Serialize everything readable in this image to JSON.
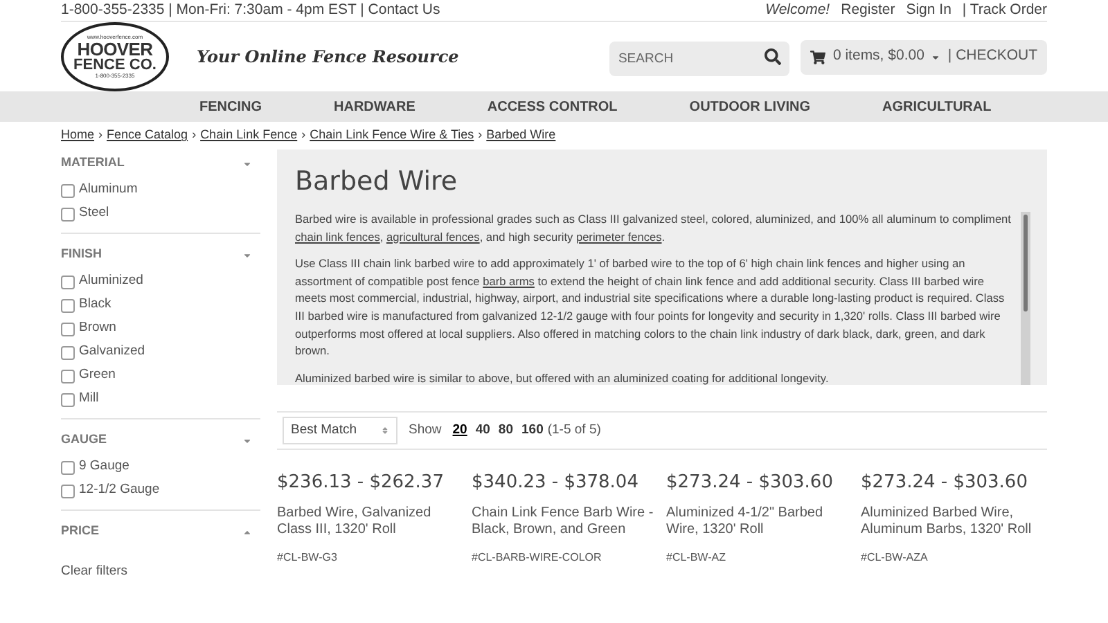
{
  "topbar": {
    "contact": "1-800-355-2335 | Mon-Fri: 7:30am - 4pm EST | Contact Us",
    "welcome": "Welcome!",
    "links": [
      "Register",
      "Sign In",
      "| Track Order"
    ]
  },
  "header": {
    "logo": {
      "url": "www.hooverfence.com",
      "name_1": "HOOVER",
      "name_2": "FENCE CO.",
      "phone": "1-800-355-2335"
    },
    "tagline": "Your Online Fence Resource",
    "search": {
      "placeholder": "SEARCH"
    },
    "cart": {
      "summary": "0 items, $0.00",
      "checkout": "| CHECKOUT"
    }
  },
  "nav": [
    "FENCING",
    "HARDWARE",
    "ACCESS CONTROL",
    "OUTDOOR LIVING",
    "AGRICULTURAL"
  ],
  "breadcrumb": {
    "separator": "›",
    "items": [
      "Home",
      "Fence Catalog",
      "Chain Link Fence",
      "Chain Link Fence Wire & Ties",
      "Barbed Wire"
    ]
  },
  "filters": [
    {
      "title": "MATERIAL",
      "expanded": true,
      "options": [
        {
          "label": "Aluminum",
          "checked": false
        },
        {
          "label": "Steel",
          "checked": false
        }
      ]
    },
    {
      "title": "FINISH",
      "expanded": true,
      "options": [
        {
          "label": "Aluminized",
          "checked": false
        },
        {
          "label": "Black",
          "checked": false
        },
        {
          "label": "Brown",
          "checked": false
        },
        {
          "label": "Galvanized",
          "checked": false
        },
        {
          "label": "Green",
          "checked": false
        },
        {
          "label": "Mill",
          "checked": false
        }
      ]
    },
    {
      "title": "GAUGE",
      "expanded": true,
      "options": [
        {
          "label": "9 Gauge",
          "checked": false
        },
        {
          "label": "12-1/2 Gauge",
          "checked": false
        }
      ]
    },
    {
      "title": "PRICE",
      "expanded": false
    }
  ],
  "clear_filters": "Clear filters",
  "category": {
    "title": "Barbed Wire",
    "paragraphs": [
      [
        {
          "kind": "text",
          "text": "Barbed wire is available in professional grades such as Class III galvanized steel, colored, aluminized, and 100% all aluminum to compliment "
        },
        {
          "kind": "link",
          "text": "chain link fences"
        },
        {
          "kind": "text",
          "text": ", "
        },
        {
          "kind": "link",
          "text": "agricultural fences"
        },
        {
          "kind": "text",
          "text": ", and high security "
        },
        {
          "kind": "link",
          "text": "perimeter fences"
        },
        {
          "kind": "text",
          "text": "."
        }
      ],
      [
        {
          "kind": "text",
          "text": "Use Class III chain link barbed wire to add approximately 1' of barbed wire to the top of 6' high chain link fences and higher using an assortment of compatible post fence "
        },
        {
          "kind": "link",
          "text": "barb arms"
        },
        {
          "kind": "text",
          "text": " to extend the height of chain link fence and add additional security. Class III barbed wire meets most commercial, industrial, highway, airport, and industrial site specifications where a durable long-lasting product is required. Class III barbed wire is manufactured from galvanized 12-1/2 gauge with four points for longevity and security in 1,320' rolls. Class III barbed wire outperforms most offered at local suppliers. Also offered in matching colors to the chain link industry of dark black, dark, green, and dark brown."
        }
      ],
      [
        {
          "kind": "text",
          "text": "Aluminized barbed wire is similar to above, but offered with an aluminized coating for additional longevity."
        }
      ]
    ]
  },
  "sort": {
    "value": "Best Match"
  },
  "page_size": {
    "label": "Show",
    "options": [
      {
        "label": "20",
        "selected": true
      },
      {
        "label": "40",
        "selected": false
      },
      {
        "label": "80",
        "selected": false
      },
      {
        "label": "160",
        "selected": false
      }
    ],
    "count": "(1-5 of 5)"
  },
  "products": [
    {
      "price": "$236.13 - $262.37",
      "name": "Barbed Wire, Galvanized Class III, 1320' Roll",
      "sku": "#CL-BW-G3"
    },
    {
      "price": "$340.23 - $378.04",
      "name": "Chain Link Fence Barb Wire - Black, Brown, and Green",
      "sku": "#CL-BARB-WIRE-COLOR"
    },
    {
      "price": "$273.24 - $303.60",
      "name": "Aluminized 4-1/2\" Barbed Wire, 1320' Roll",
      "sku": "#CL-BW-AZ"
    },
    {
      "price": "$273.24 - $303.60",
      "name": "Aluminized Barbed Wire, Aluminum Barbs, 1320' Roll",
      "sku": "#CL-BW-AZA"
    }
  ]
}
